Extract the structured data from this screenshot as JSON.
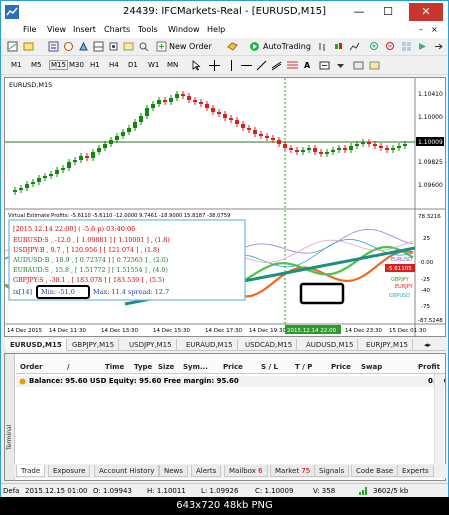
{
  "window": {
    "title": "24439: IFCMarkets-Real - [EURUSD,M15]",
    "minimize": "—",
    "maximize": "☐",
    "close": "✕"
  },
  "menu": [
    "File",
    "View",
    "Insert",
    "Charts",
    "Tools",
    "Window",
    "Help"
  ],
  "toolbar": {
    "new_order": "New Order",
    "autotrading": "AutoTrading"
  },
  "timeframes": [
    "M1",
    "M5",
    "M15",
    "M30",
    "H1",
    "H4",
    "D1",
    "W1",
    "MN"
  ],
  "chart": {
    "symbol_label": "EURUSD,M15",
    "price_labels": [
      "1.10410",
      "1.10000",
      "1.09825",
      "1.09600",
      "1.10009"
    ],
    "current_price": "1.10009",
    "indicator_header": "Virtual Estimate Profits: -5.6110 -5.6110 -12.0000 9.7461 -18.9000 15.8187 -38.0759",
    "indicator_axis": [
      "78.3216",
      "25",
      "0.00",
      "-25",
      "-40",
      "-75",
      "-87.5248"
    ],
    "indicator_tag": "-5.61105",
    "series_labels": [
      "EURUSD",
      "GBPJPY",
      "EURJPY",
      "GBPUSD"
    ],
    "info_box": {
      "header": "[2015.12.14 22:00]   ( -5.6 p)      03:40:06",
      "lines": [
        "EURUSD:S , -12.0 ,  [ 1.09881 ] [ 1.10001 ] , (1.8)",
        "USDJPY:B , 9.7 ,   [ 120.956 ] [ 121.074 ] , (1.8)",
        "AUDUSD:B , 18.9 ,  [ 0.72374 ] [ 0.72563 ] , (2.0)",
        "EURAUD:S , 15.8 ,  [ 1.51772 ] [ 1.51554 ] , (4.0)",
        "GBPJPY:S , -38.1 , [ 183.078 ] [ 183.539 ] , (5.5)"
      ],
      "footer_prefix": "ix[14]",
      "footer_min": "Min: -51.0",
      "footer_rest": "Max: 11.4   spread: 12.7"
    },
    "time_labels": [
      "14 Dec 2015",
      "14 Dec 11:30",
      "14 Dec 13:30",
      "14 Dec 15:30",
      "14 Dec 17:30",
      "14 Dec 19:30",
      "2015.12.14 22:00",
      "14 Dec 23:30",
      "15 Dec 01:30"
    ]
  },
  "chart_tabs": [
    "EURUSD,M15",
    "GBPJPY,M15",
    "USDJPY,M15",
    "EURAUD,M15",
    "USDCAD,M15",
    "AUDUSD,M15",
    "EURJPY,M15"
  ],
  "terminal": {
    "side_label": "Terminal",
    "columns": [
      "Order",
      "/",
      "Time",
      "Type",
      "Size",
      "Sym...",
      "Price",
      "S / L",
      "T / P",
      "Price",
      "Swap",
      "Profit"
    ],
    "balance_text": "Balance: 95.60 USD  Equity: 95.60  Free margin: 95.60",
    "balance_profit": "0.00",
    "tabs": [
      "Trade",
      "Exposure",
      "Account History",
      "News",
      "Alerts",
      "Mailbox",
      "Market",
      "Signals",
      "Code Base",
      "Experts"
    ],
    "mailbox_badge": "6",
    "market_badge": "75"
  },
  "status": {
    "default": "Defa",
    "datetime": "2015.12.15 01:00",
    "open": "O: 1.09943",
    "high": "H: 1.10011",
    "low": "L: 1.09926",
    "close": "C: 1.10009",
    "volume": "V: 358",
    "traffic": "3602/5 kb"
  },
  "caption": "643x720  48kb  PNG",
  "colors": {
    "bull": "#0f8a0f",
    "bear": "#d82020",
    "trend": "#1a9080",
    "highlight": "#000000"
  }
}
